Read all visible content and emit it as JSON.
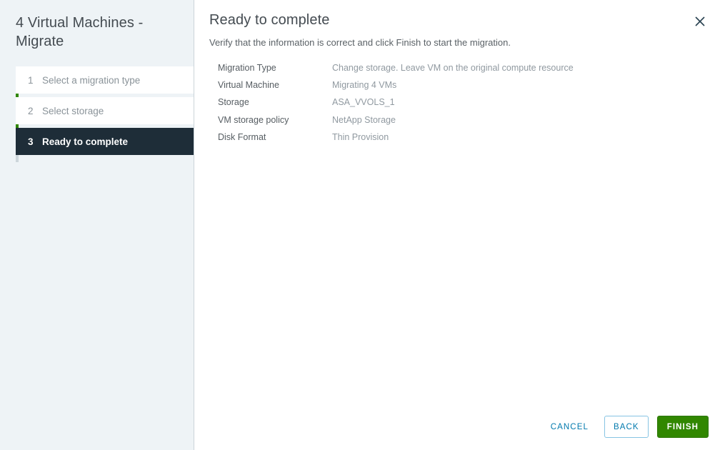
{
  "sidebar": {
    "title": "4 Virtual Machines - Migrate",
    "steps": [
      {
        "number": "1",
        "label": "Select a migration type",
        "state": "completed"
      },
      {
        "number": "2",
        "label": "Select storage",
        "state": "completed"
      },
      {
        "number": "3",
        "label": "Ready to complete",
        "state": "active"
      }
    ]
  },
  "header": {
    "title": "Ready to complete",
    "subtitle": "Verify that the information is correct and click Finish to start the migration.",
    "close_icon": "close-icon"
  },
  "details": [
    {
      "label": "Migration Type",
      "value": "Change storage. Leave VM on the original compute resource"
    },
    {
      "label": "Virtual Machine",
      "value": "Migrating 4 VMs"
    },
    {
      "label": "Storage",
      "value": "ASA_VVOLS_1"
    },
    {
      "label": "VM storage policy",
      "value": "NetApp Storage"
    },
    {
      "label": "Disk Format",
      "value": "Thin Provision"
    }
  ],
  "footer": {
    "cancel_label": "CANCEL",
    "back_label": "BACK",
    "finish_label": "FINISH"
  },
  "colors": {
    "accent_green": "#318700",
    "link_blue": "#0079ad",
    "active_step_bg": "#1e2d38",
    "sidebar_bg": "#eef3f6"
  }
}
